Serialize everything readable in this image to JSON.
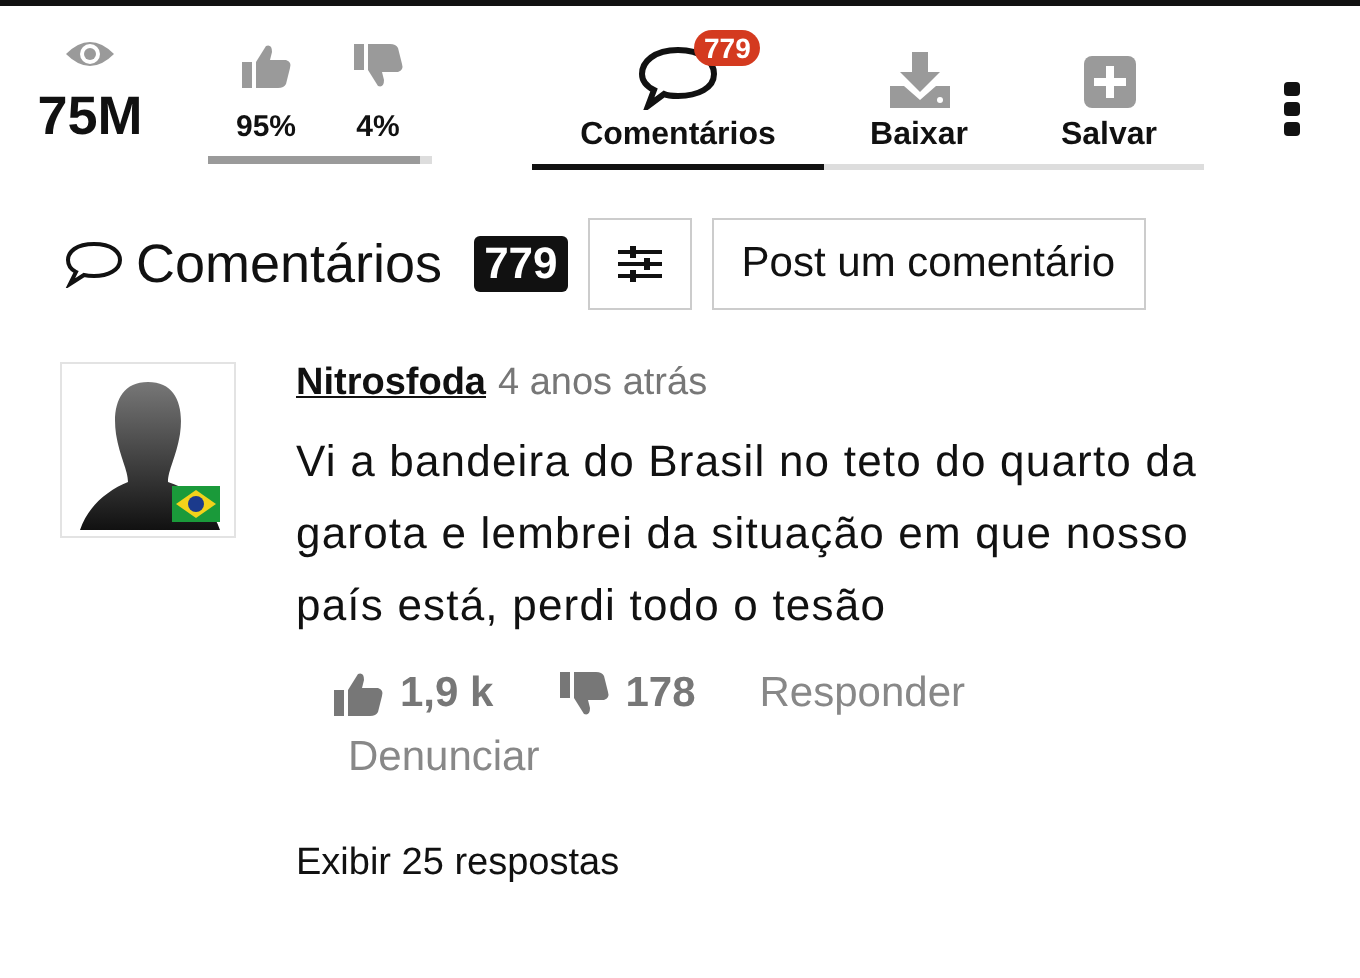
{
  "stats": {
    "views": "75M",
    "like_percent": "95%",
    "dislike_percent": "4%",
    "rating_bar": {
      "level": 0.95
    }
  },
  "tabs": [
    {
      "kind": "comments",
      "label": "Comentários",
      "badge": "779",
      "selected": true
    },
    {
      "kind": "download",
      "label": "Baixar",
      "selected": false
    },
    {
      "kind": "save",
      "label": "Salvar",
      "selected": false
    }
  ],
  "comments_header": {
    "title": "Comentários",
    "count": "779",
    "post_button": "Post um comentário"
  },
  "comments": [
    {
      "author": "Nitrosfoda",
      "time": "4 anos atrás",
      "text": "Vi a bandeira do Brasil no teto do quarto da garota e lembrei da situação em que nosso país está, perdi todo o tesão",
      "likes": "1,9 k",
      "dislikes": "178",
      "reply": "Responder",
      "report": "Denunciar",
      "show_replies": "Exibir 25 respostas"
    }
  ]
}
